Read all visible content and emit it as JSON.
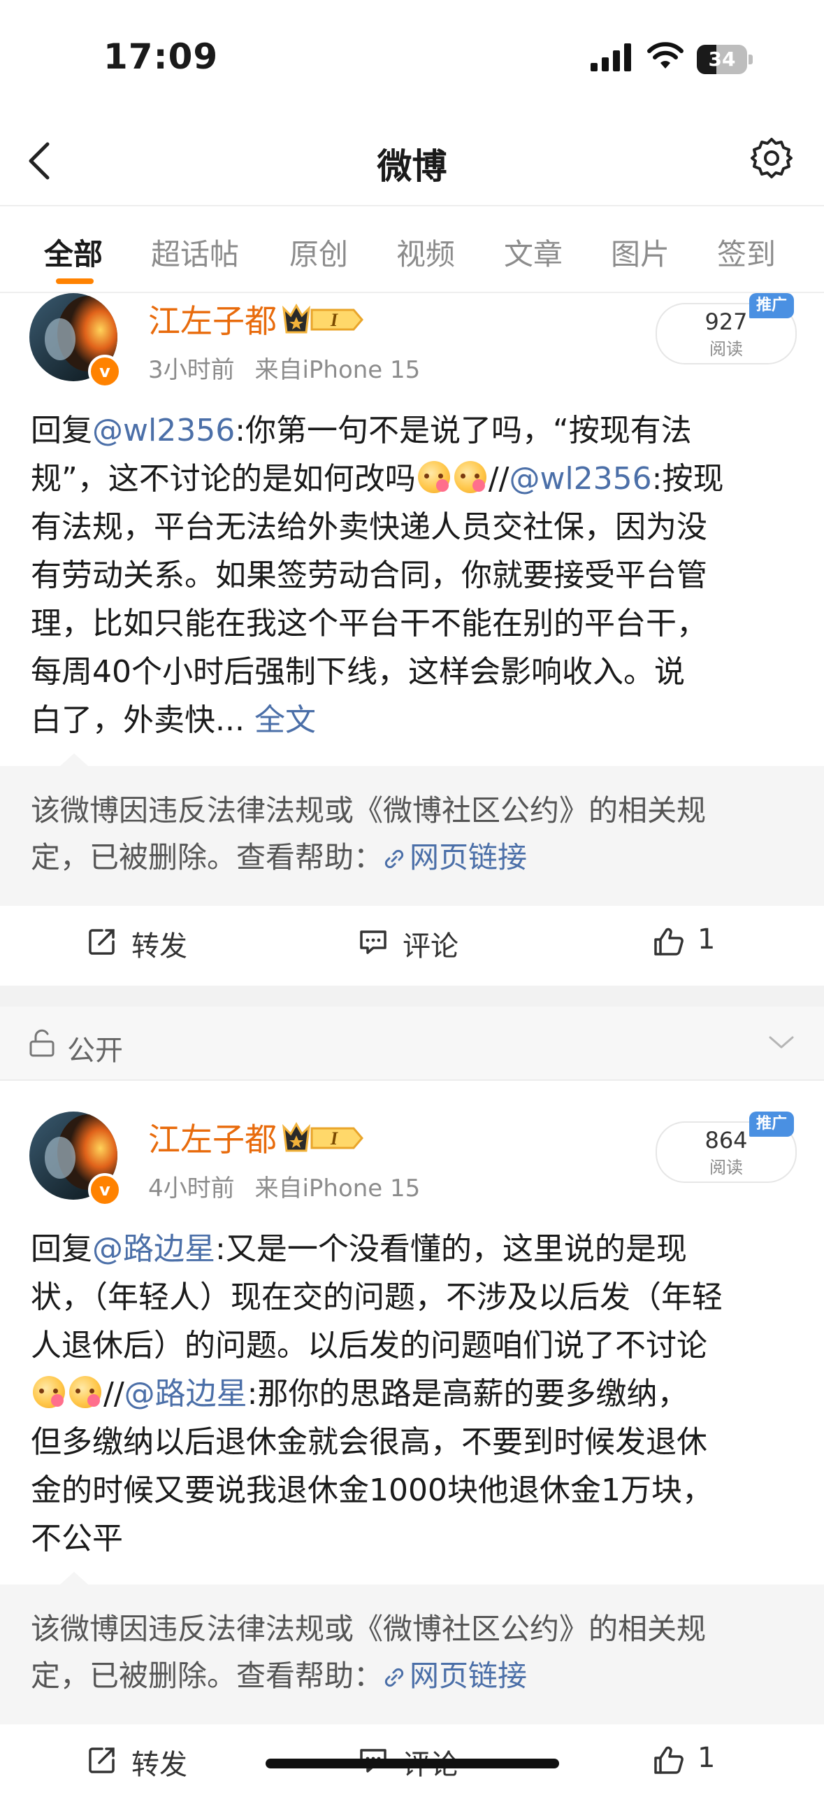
{
  "status_bar": {
    "time": "17:09",
    "battery": "34"
  },
  "nav": {
    "title": "微博"
  },
  "tabs": [
    "全部",
    "超话帖",
    "原创",
    "视频",
    "文章",
    "图片",
    "签到"
  ],
  "posts": [
    {
      "author": "江左子都",
      "verified_badge": "v",
      "time": "3小时前",
      "source": "来自iPhone 15",
      "reads": "927",
      "reads_label": "阅读",
      "promo": "推广",
      "text": {
        "l1_a": "回复",
        "l1_mention": "@wl2356",
        "l1_b": ":你第一句不是说了吗，“按现有法",
        "l2_a": "规”，这不讨论的是如何改吗",
        "l2_sep": "//",
        "l2_mention": "@wl2356",
        "l2_b": ":按现",
        "l3": "有法规，平台无法给外卖快递人员交社保，因为没",
        "l4": "有劳动关系。如果签劳动合同，你就要接受平台管",
        "l5": "理，比如只能在我这个平台干不能在别的平台干，",
        "l6": "每周40个小时后强制下线，这样会影响收入。说",
        "l7": "白了，外卖快...",
        "more": "全文"
      },
      "deleted": {
        "l1": "该微博因违反法律法规或《微博社区公约》的相关规",
        "l2": "定，已被删除。查看帮助：",
        "link": "网页链接"
      },
      "actions": {
        "repost": "转发",
        "comment": "评论",
        "like": "1"
      }
    },
    {
      "author": "江左子都",
      "verified_badge": "v",
      "time": "4小时前",
      "source": "来自iPhone 15",
      "reads": "864",
      "reads_label": "阅读",
      "promo": "推广",
      "text": {
        "l1_a": "回复",
        "l1_mention": "@路边星",
        "l1_b": ":又是一个没看懂的，这里说的是现",
        "l2": "状，（年轻人）现在交的问题，不涉及以后发（年轻",
        "l3": "人退休后）的问题。以后发的问题咱们说了不讨论",
        "l4_sep": "//",
        "l4_mention": "@路边星",
        "l4_b": ":那你的思路是高薪的要多缴纳，",
        "l5": "但多缴纳以后退休金就会很高，不要到时候发退休",
        "l6": "金的时候又要说我退休金1000块他退休金1万块，",
        "l7": "不公平"
      },
      "deleted": {
        "l1": "该微博因违反法律法规或《微博社区公约》的相关规",
        "l2": "定，已被删除。查看帮助：",
        "link": "网页链接"
      },
      "actions": {
        "repost": "转发",
        "comment": "评论",
        "like": "1"
      }
    }
  ],
  "public_bar": {
    "label": "公开"
  },
  "colors": {
    "accent": "#ff8200",
    "username": "#e86b0c",
    "link": "#4b6fa8",
    "promo": "#4a90e2"
  }
}
